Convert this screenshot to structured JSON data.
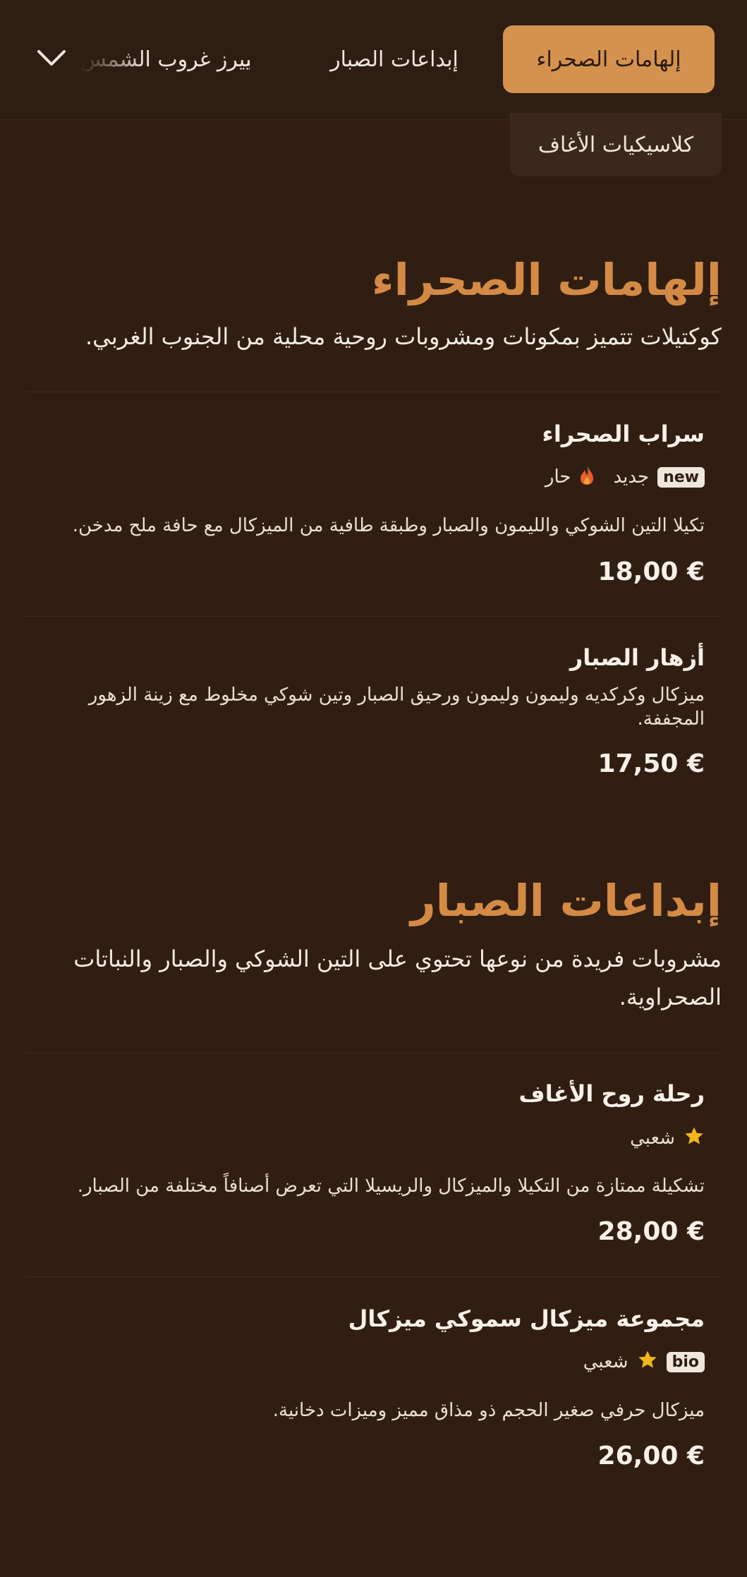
{
  "nav": {
    "tabs": [
      {
        "label": "إلهامات الصحراء",
        "active": true
      },
      {
        "label": "إبداعات الصبار",
        "active": false
      },
      {
        "label": "سييرز غروب الشمس",
        "active": false
      },
      {
        "label": "كلاسيكيات الأغاف",
        "active": false
      }
    ],
    "icon": "chevron-down-icon"
  },
  "sections": [
    {
      "title": "إلهامات الصحراء",
      "description": "كوكتيلات تتميز بمكونات ومشروبات روحية محلية من الجنوب الغربي.",
      "items": [
        {
          "name": "سراب الصحراء",
          "badge": "new",
          "tags": [
            "جديد",
            "حار"
          ],
          "tag_icons": [
            "fire-icon"
          ],
          "description": "تكيلا التين الشوكي والليمون والصبار وطبقة طافية من الميزكال مع حافة ملح مدخن.",
          "price": "18,00 €"
        },
        {
          "name": "أزهار الصبار",
          "description": "ميزكال وكركديه وليمون وليمون ورحيق الصبار وتين شوكي مخلوط مع زينة الزهور المجففة.",
          "price": "17,50 €"
        }
      ]
    },
    {
      "title": "إبداعات الصبار",
      "description": "مشروبات فريدة من نوعها تحتوي على التين الشوكي والصبار والنباتات الصحراوية.",
      "items": [
        {
          "name": "رحلة روح الأغاف",
          "tags": [
            "شعبي"
          ],
          "tag_icons": [
            "star-icon"
          ],
          "description": "تشكيلة ممتازة من التكيلا والميزكال والريسيلا التي تعرض أصنافاً مختلفة من الصبار.",
          "price": "28,00 €"
        },
        {
          "name": "مجموعة ميزكال سموكي ميزكال",
          "badge": "bio",
          "tags": [
            "شعبي"
          ],
          "tag_icons": [
            "star-icon"
          ],
          "description": "ميزكال حرفي صغير الحجم ذو مذاق مميز وميزات دخانية.",
          "price": "26,00 €"
        }
      ]
    }
  ],
  "colors": {
    "background": "#301e13",
    "accent": "#d5924f",
    "heading": "#d48a45",
    "text": "#f3ebe2",
    "star": "#f2b51b",
    "fire": "#e8602a"
  }
}
